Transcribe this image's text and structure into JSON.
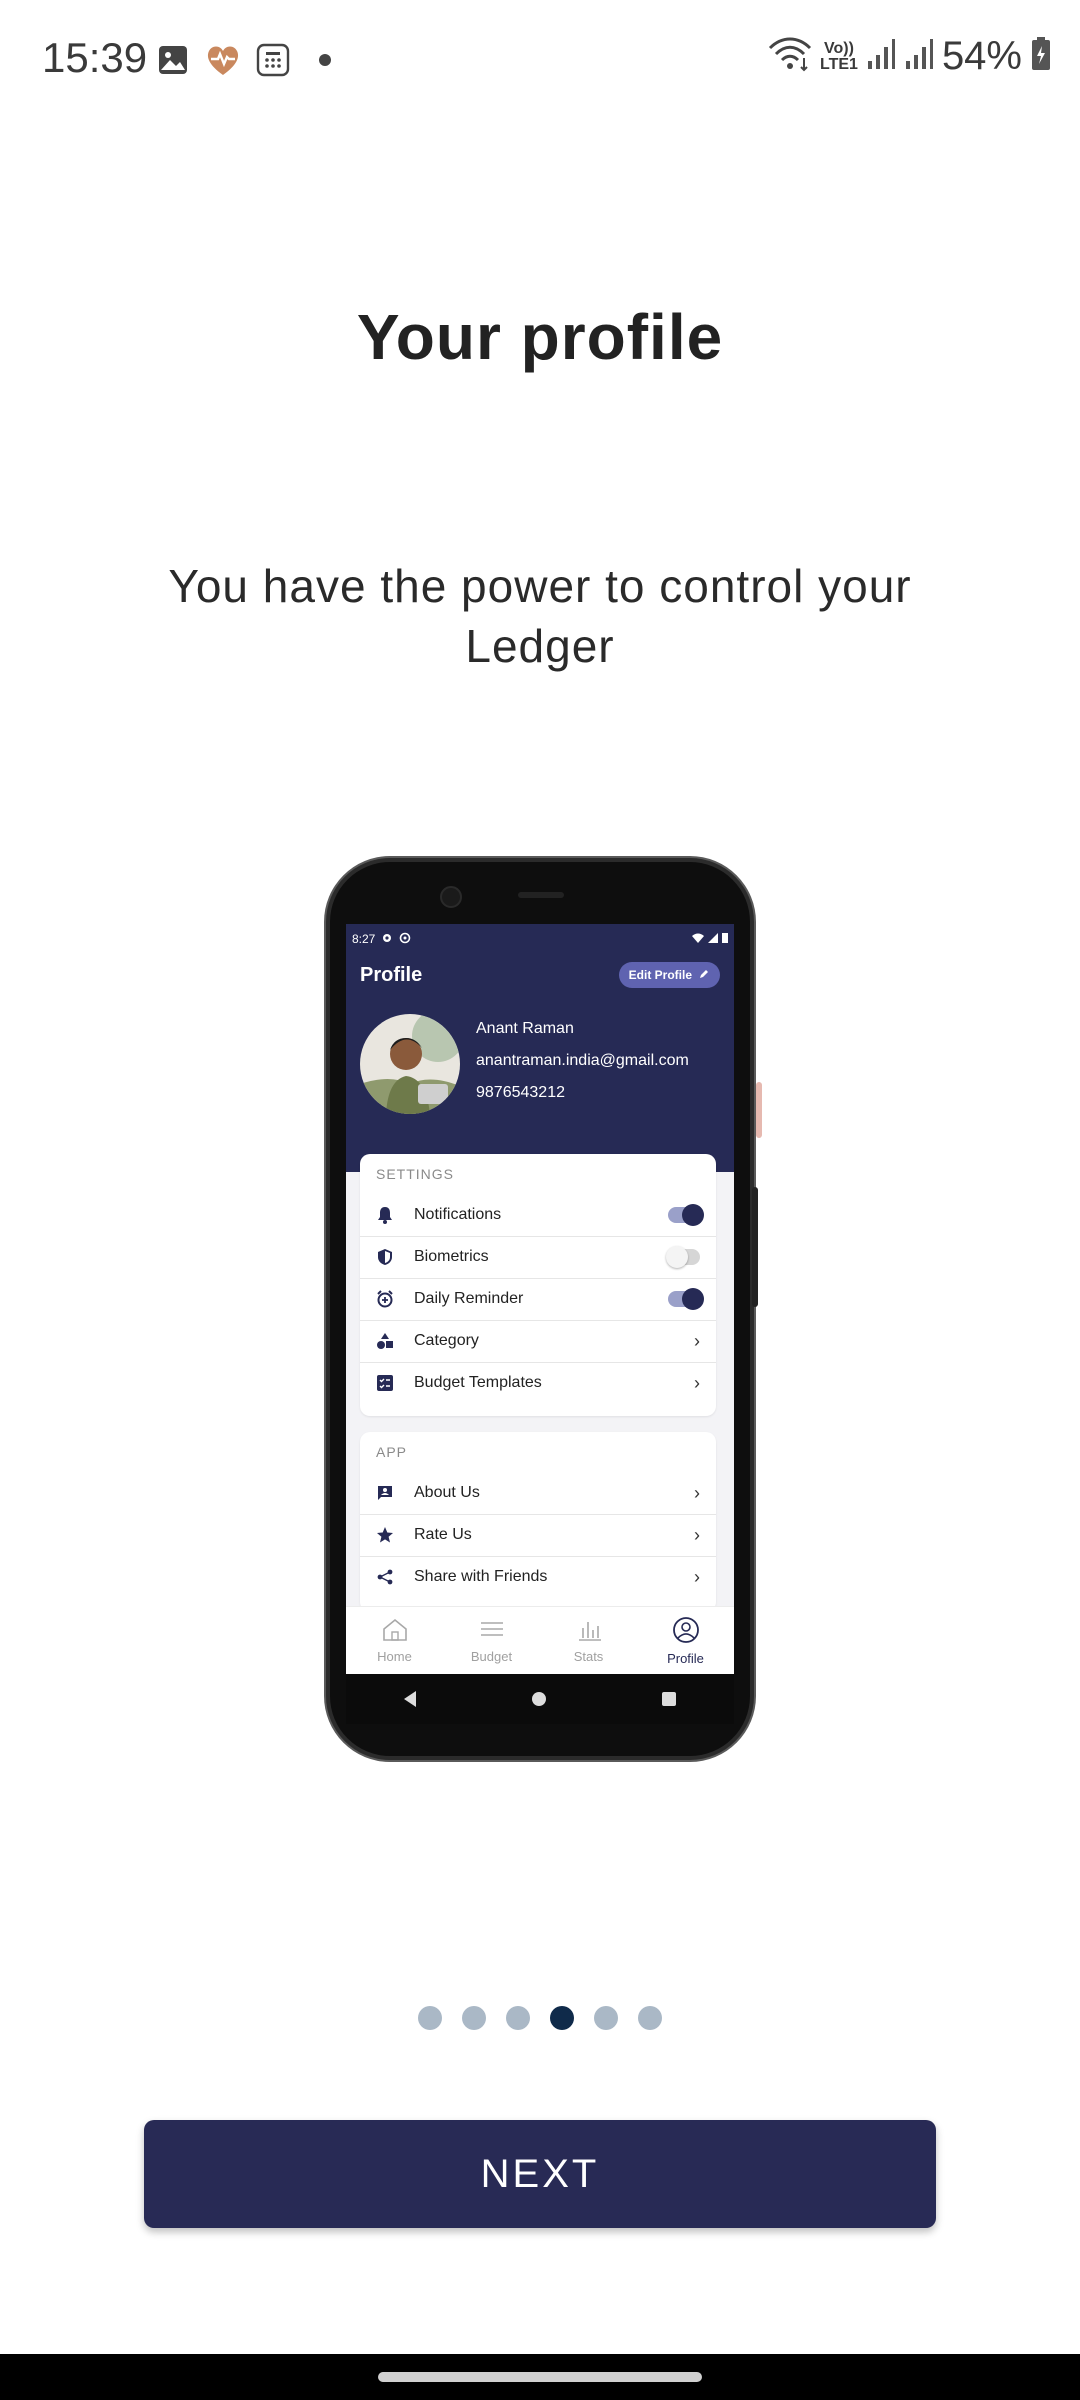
{
  "status_bar": {
    "time": "15:39",
    "battery": "54%",
    "volte": "Vo))",
    "lte": "LTE1",
    "icons": [
      "gallery-icon",
      "health-icon",
      "calculator-icon",
      "wifi-icon",
      "signal-icon",
      "battery-icon"
    ]
  },
  "onboarding": {
    "title": "Your profile",
    "subtitle": "You have the power to control your Ledger",
    "next_label": "NEXT",
    "pager": {
      "count": 6,
      "active_index": 3
    }
  },
  "mock": {
    "status_time": "8:27",
    "header_title": "Profile",
    "edit_label": "Edit Profile",
    "name": "Anant Raman",
    "email": "anantraman.india@gmail.com",
    "phone": "9876543212",
    "settings_heading": "SETTINGS",
    "settings": [
      {
        "label": "Notifications",
        "icon": "bell-icon",
        "type": "toggle",
        "on": true
      },
      {
        "label": "Biometrics",
        "icon": "shield-icon",
        "type": "toggle",
        "on": false
      },
      {
        "label": "Daily Reminder",
        "icon": "alarm-icon",
        "type": "toggle",
        "on": true
      },
      {
        "label": "Category",
        "icon": "shapes-icon",
        "type": "chevron"
      },
      {
        "label": "Budget Templates",
        "icon": "checklist-icon",
        "type": "chevron"
      }
    ],
    "app_heading": "APP",
    "app_items": [
      {
        "label": "About Us",
        "icon": "person-card-icon"
      },
      {
        "label": "Rate Us",
        "icon": "star-icon"
      },
      {
        "label": "Share with Friends",
        "icon": "share-icon"
      }
    ],
    "nav": [
      {
        "label": "Home",
        "icon": "home-icon"
      },
      {
        "label": "Budget",
        "icon": "list-icon"
      },
      {
        "label": "Stats",
        "icon": "bar-chart-icon"
      },
      {
        "label": "Profile",
        "icon": "profile-icon",
        "active": true
      }
    ]
  },
  "colors": {
    "brand": "#262a55",
    "button": "#282a55",
    "dot_active": "#0f2a4a",
    "dot_inactive": "#aab8c6"
  }
}
